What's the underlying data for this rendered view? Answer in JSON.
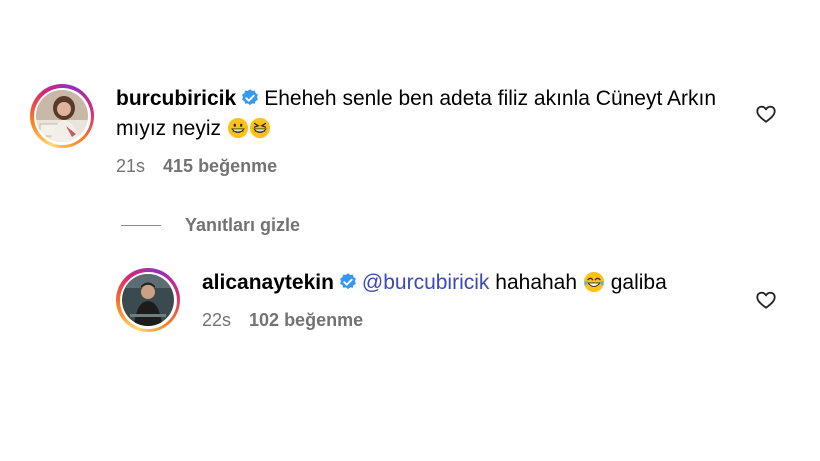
{
  "comments": [
    {
      "username": "burcubiricik",
      "text": "Eheheh senle ben adeta filiz akınla Cüneyt Arkın mıyız neyiz",
      "emojis": [
        "grinning-face-emoji",
        "squinting-face-emoji"
      ],
      "time": "21s",
      "likes": "415 beğenme"
    },
    {
      "username": "alicanaytekin",
      "mention": "@burcubiricik",
      "text_before_emoji": "hahahah",
      "emoji": "tears-of-joy-emoji",
      "text_after_emoji": "galiba",
      "time": "22s",
      "likes": "102 beğenme"
    }
  ],
  "replies_toggle": {
    "label": "Yanıtları gizle"
  },
  "colors": {
    "verified": "#3897f0",
    "mention": "#3a4bb8",
    "meta": "#737373"
  }
}
